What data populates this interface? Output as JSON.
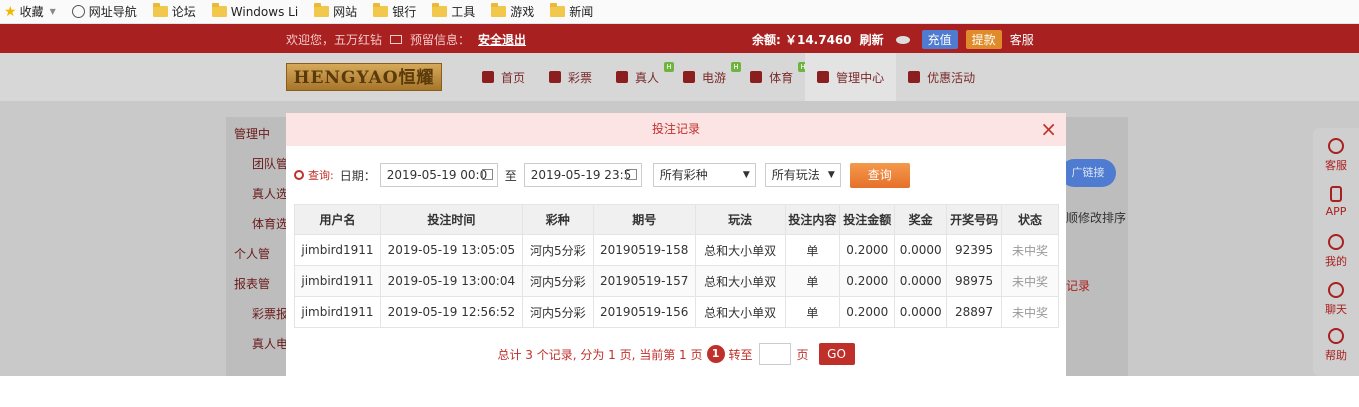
{
  "bookmarks": {
    "items": [
      {
        "label": "收藏",
        "icon": "star-icon"
      },
      {
        "label": "网址导航",
        "icon": "globe-icon"
      },
      {
        "label": "论坛",
        "icon": "folder-icon"
      },
      {
        "label": "Windows Li",
        "icon": "folder-icon"
      },
      {
        "label": "网站",
        "icon": "folder-icon"
      },
      {
        "label": "银行",
        "icon": "folder-icon"
      },
      {
        "label": "工具",
        "icon": "folder-icon"
      },
      {
        "label": "游戏",
        "icon": "folder-icon"
      },
      {
        "label": "新闻",
        "icon": "folder-icon"
      }
    ]
  },
  "topbar": {
    "welcome": "欢迎您，五万红钻",
    "reserve_label": "预留信息：",
    "logout": "安全退出",
    "balance": "余额: ￥14.7460",
    "refresh": "刷新",
    "recharge": "充值",
    "withdraw": "提款",
    "service": "客服"
  },
  "nav": {
    "logo_text": "HENGYAO恒耀",
    "items": [
      {
        "label": "首页",
        "badge": ""
      },
      {
        "label": "彩票",
        "badge": ""
      },
      {
        "label": "真人",
        "badge": "H"
      },
      {
        "label": "电游",
        "badge": "H"
      },
      {
        "label": "体育",
        "badge": "H"
      },
      {
        "label": "管理中心",
        "badge": ""
      },
      {
        "label": "优惠活动",
        "badge": ""
      }
    ]
  },
  "sidebar": {
    "items": [
      "管理中",
      "团队管",
      "真人选",
      "体育选",
      "个人管",
      "报表管",
      "彩票报",
      "真人电"
    ]
  },
  "right_panel": {
    "link_button": "广链接",
    "sort_text": "顺修改排序",
    "record_text": "记录"
  },
  "floatbar": {
    "items": [
      "客服",
      "APP",
      "我的",
      "聊天",
      "帮助"
    ]
  },
  "modal": {
    "title": "投注记录",
    "close": "×",
    "filter": {
      "query_label": "查询:",
      "date_label": "日期：",
      "start_date": "2019-05-19 00:0",
      "to_label": "至",
      "end_date": "2019-05-19 23:5",
      "lottery_select": "所有彩种",
      "play_select": "所有玩法",
      "query_button": "查询"
    },
    "table": {
      "columns": [
        "用户名",
        "投注时间",
        "彩种",
        "期号",
        "玩法",
        "投注内容",
        "投注金额",
        "奖金",
        "开奖号码",
        "状态"
      ],
      "rows": [
        [
          "jimbird1911",
          "2019-05-19 13:05:05",
          "河内5分彩",
          "20190519-158",
          "总和大小单双",
          "单",
          "0.2000",
          "0.0000",
          "92395",
          "未中奖"
        ],
        [
          "jimbird1911",
          "2019-05-19 13:00:04",
          "河内5分彩",
          "20190519-157",
          "总和大小单双",
          "单",
          "0.2000",
          "0.0000",
          "98975",
          "未中奖"
        ],
        [
          "jimbird1911",
          "2019-05-19 12:56:52",
          "河内5分彩",
          "20190519-156",
          "总和大小单双",
          "单",
          "0.2000",
          "0.0000",
          "28897",
          "未中奖"
        ]
      ]
    },
    "pager": {
      "summary": "总计 3 个记录, 分为 1 页, 当前第 1 页",
      "current": "1",
      "goto_label": "转至",
      "page_unit": "页",
      "go_button": "GO"
    }
  },
  "colors": {
    "brand_red": "#a8201f",
    "accent_orange": "#e6702a",
    "blue_button": "#4f7bd0"
  }
}
